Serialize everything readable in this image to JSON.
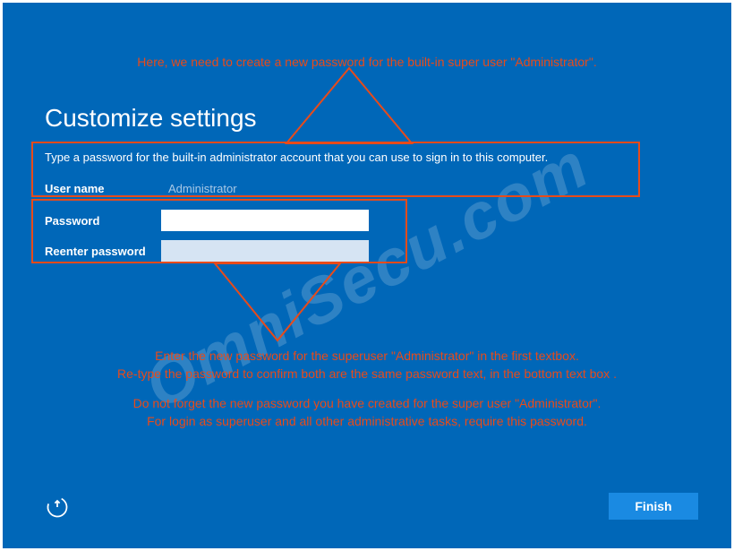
{
  "watermark": "OmniSecu.com",
  "setup": {
    "title": "Customize settings",
    "instruction": "Type a password for the built-in administrator account that you can use to sign in to this computer.",
    "username_label": "User name",
    "username_value": "Administrator",
    "password_label": "Password",
    "reenter_label": "Reenter password",
    "finish_label": "Finish"
  },
  "annotations": {
    "top": "Here, we need to create a new password for the built-in super user \"Administrator\".",
    "mid_line1": "Enter the new password for the superuser \"Administrator\" in the first textbox.",
    "mid_line2": "Re-type the password to confirm both are the same password text, in the bottom text box .",
    "mid_line3": "Do not forget the new password you have created for the super user \"Administrator\".",
    "mid_line4": "For login as superuser and all other administrative tasks, require this password."
  },
  "colors": {
    "bg": "#0067b8",
    "accent": "#e84b1a",
    "button": "#1a8ae2"
  }
}
